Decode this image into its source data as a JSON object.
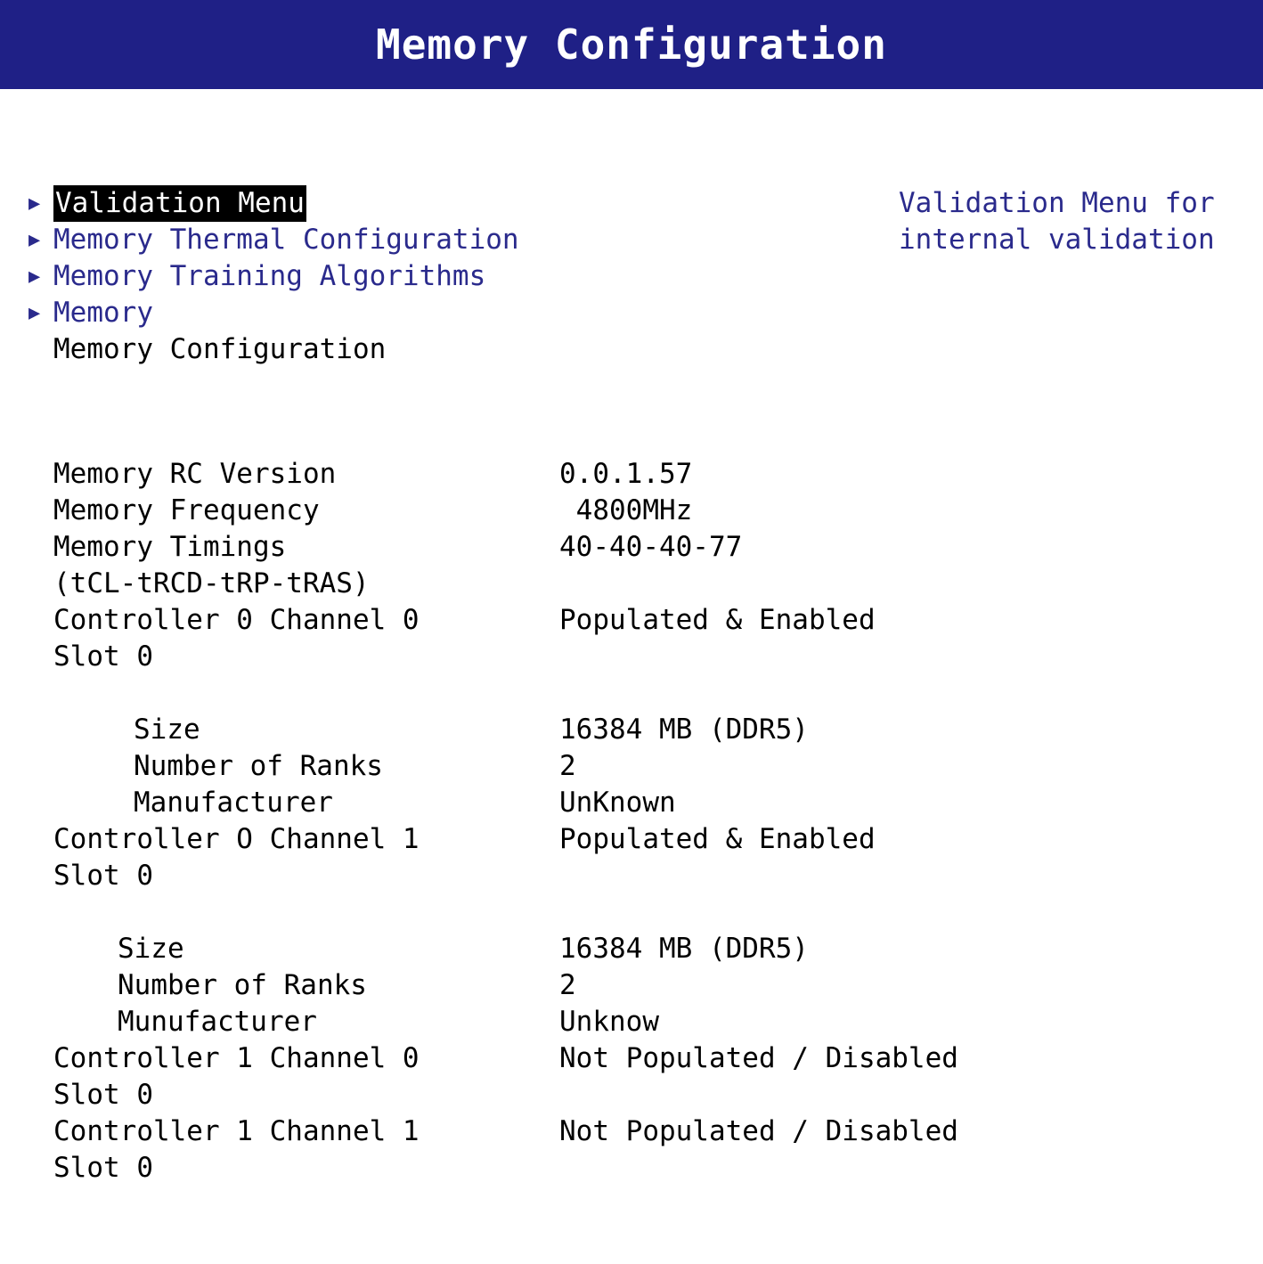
{
  "title_bar": {
    "title": "Memory Configuration"
  },
  "menu": {
    "arrow_icon": "▶",
    "items": [
      {
        "label": "Validation Menu",
        "has_arrow": true,
        "selected": true,
        "style": "link"
      },
      {
        "label": "Memory Thermal Configuration",
        "has_arrow": true,
        "selected": false,
        "style": "link"
      },
      {
        "label": "Memory Training Algorithms",
        "has_arrow": true,
        "selected": false,
        "style": "link"
      },
      {
        "label": "Memory",
        "has_arrow": true,
        "selected": false,
        "style": "link"
      },
      {
        "label": "Memory Configuration",
        "has_arrow": false,
        "selected": false,
        "style": "plain"
      }
    ]
  },
  "help": {
    "lines": [
      "Validation Menu for",
      "internal validation"
    ]
  },
  "info": {
    "rows": [
      {
        "label": "Memory RC Version",
        "value": "0.0.1.57",
        "indent": "none"
      },
      {
        "label": "Memory Frequency",
        "value": " 4800MHz",
        "indent": "none"
      },
      {
        "label": "Memory Timings",
        "value": "40-40-40-77",
        "indent": "none"
      },
      {
        "label": "(tCL-tRCD-tRP-tRAS)",
        "value": "",
        "indent": "none"
      },
      {
        "label": "Controller 0 Channel 0",
        "value": "Populated & Enabled",
        "indent": "none"
      },
      {
        "label": "Slot 0",
        "value": "",
        "indent": "none"
      },
      {
        "label": "Size",
        "value": "16384 MB (DDR5)",
        "indent": "a"
      },
      {
        "label": "Number of Ranks",
        "value": "2",
        "indent": "a"
      },
      {
        "label": "Manufacturer",
        "value": "UnKnown",
        "indent": "a"
      },
      {
        "label": "Controller O Channel 1",
        "value": "Populated & Enabled",
        "indent": "none"
      },
      {
        "label": "Slot 0",
        "value": "",
        "indent": "none"
      },
      {
        "label": "Size",
        "value": "16384 MB (DDR5)",
        "indent": "b"
      },
      {
        "label": "Number of Ranks",
        "value": "2",
        "indent": "b"
      },
      {
        "label": "Munufacturer",
        "value": "Unknow",
        "indent": "b"
      },
      {
        "label": "Controller 1 Channel 0",
        "value": "Not Populated / Disabled",
        "indent": "none"
      },
      {
        "label": "Slot 0",
        "value": "",
        "indent": "none"
      },
      {
        "label": "Controller 1 Channel 1",
        "value": "Not Populated / Disabled",
        "indent": "none"
      },
      {
        "label": "Slot 0",
        "value": "",
        "indent": "none"
      }
    ]
  },
  "colors": {
    "title_bar_background": "#1f2086",
    "title_text": "#ffffff",
    "menu_link": "#2a2a8c",
    "selection_background": "#000000",
    "selection_text": "#ffffff",
    "body_text": "#000000",
    "page_background": "#ffffff"
  }
}
